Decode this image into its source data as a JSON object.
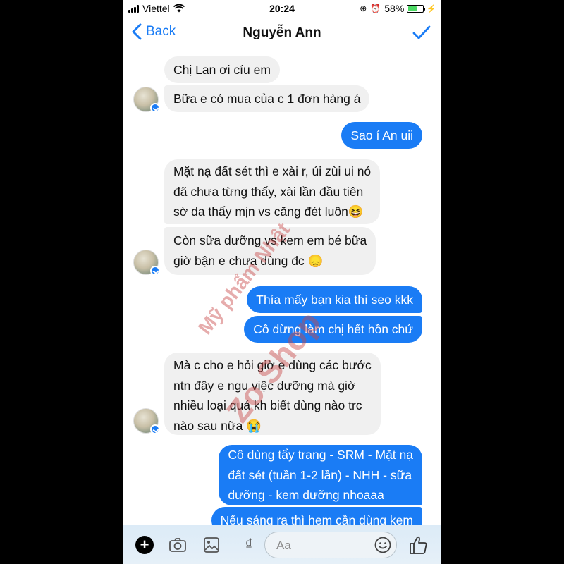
{
  "status_bar": {
    "carrier": "Viettel",
    "time": "20:24",
    "battery": "58%",
    "battery_level": 0.58
  },
  "nav": {
    "back_label": "Back",
    "contact_name": "Nguyễn Ann"
  },
  "messages": [
    {
      "side": "in",
      "text": "Chị Lan ơi cíu em"
    },
    {
      "side": "in",
      "text": "Bữa e có mua của c 1 đơn hàng á"
    },
    {
      "side": "out",
      "text": "Sao í An uii"
    },
    {
      "side": "in",
      "text": "Mặt nạ đất sét thì e xài r, úi zùi ui nó\nđã chưa từng thấy, xài lần đầu tiên\nsờ da thấy mịn vs căng đét luôn😆"
    },
    {
      "side": "in",
      "text": "Còn sữa dưỡng vs kem em bé bữa\ngiờ bận e chưa dùng đc 😞"
    },
    {
      "side": "out",
      "text": "Thía mấy bạn kia thì seo kkk"
    },
    {
      "side": "out",
      "text": "Cô dừng làm chị hết hồn chứ"
    },
    {
      "side": "in",
      "text": "Mà c cho e hỏi giờ e dùng các bước\nntn đây e ngu việc dưỡng mà giờ\nnhiều loại quá kh biết dùng nào trc\nnào sau nữa 😭"
    },
    {
      "side": "out",
      "text": "Cô dùng tẩy trang - SRM - Mặt nạ\nđất sét (tuần 1-2 lần) - NHH - sữa\ndưỡng - kem dưỡng nhoaaa"
    },
    {
      "side": "out",
      "text": "Nếu sáng ra thì hem cần dùng kem"
    }
  ],
  "watermark": {
    "line1": "Mỹ phẩm Nhật",
    "line2": "Zo Shop"
  },
  "composer": {
    "placeholder": "Aa",
    "money_symbol": "₫",
    "plus_symbol": "+"
  },
  "colors": {
    "accent": "#1a7cf5",
    "incoming_bubble": "#f0f0f0",
    "watermark": "#c84646"
  },
  "icons": [
    "plus-icon",
    "camera-icon",
    "photo-icon",
    "money-icon",
    "emoji-icon",
    "like-icon",
    "messenger-badge-icon",
    "back-chevron-icon",
    "checkmark-icon"
  ]
}
